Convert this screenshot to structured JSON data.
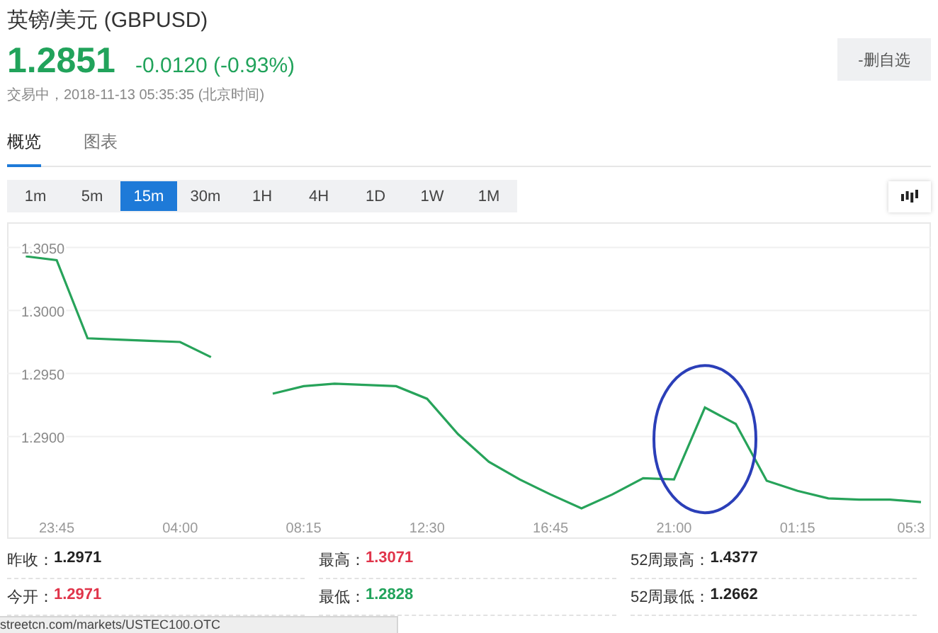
{
  "header": {
    "title": "英镑/美元 (GBPUSD)",
    "price": "1.2851",
    "change": "-0.0120 (-0.93%)",
    "status": "交易中，2018-11-13 05:35:35 (北京时间)",
    "watch_button": "-删自选"
  },
  "tabs": [
    {
      "label": "概览",
      "selected": true
    },
    {
      "label": "图表",
      "selected": false
    }
  ],
  "periods": [
    {
      "label": "1m",
      "selected": false
    },
    {
      "label": "5m",
      "selected": false
    },
    {
      "label": "15m",
      "selected": true
    },
    {
      "label": "30m",
      "selected": false
    },
    {
      "label": "1H",
      "selected": false
    },
    {
      "label": "4H",
      "selected": false
    },
    {
      "label": "1D",
      "selected": false
    },
    {
      "label": "1W",
      "selected": false
    },
    {
      "label": "1M",
      "selected": false
    }
  ],
  "chart": {
    "chart_data": {
      "type": "line",
      "grid": true,
      "ylim": [
        1.282,
        1.307
      ],
      "categories": [
        null,
        "23:45",
        null,
        null,
        null,
        "04:00",
        null,
        null,
        null,
        "08:15",
        null,
        null,
        null,
        "12:30",
        null,
        null,
        null,
        "16:45",
        null,
        null,
        null,
        "21:00",
        null,
        null,
        null,
        "01:15",
        null,
        null,
        null,
        "05:3"
      ],
      "yticks": [
        {
          "value": 1.305,
          "label": "1.3050"
        },
        {
          "value": 1.3,
          "label": "1.3000"
        },
        {
          "value": 1.295,
          "label": "1.2950"
        },
        {
          "value": 1.29,
          "label": "1.2900"
        }
      ],
      "series": [
        {
          "color": "#27a35a",
          "values": [
            1.3043,
            1.304,
            1.2978,
            1.2977,
            1.2976,
            1.2975,
            1.2963,
            null,
            1.2934,
            1.294,
            1.2942,
            1.2941,
            1.294,
            1.293,
            1.2902,
            1.288,
            1.2866,
            1.2854,
            1.2843,
            1.2854,
            1.2867,
            1.2866,
            1.2923,
            1.291,
            1.2865,
            1.2857,
            1.2851,
            1.285,
            1.285,
            1.2848
          ]
        }
      ]
    },
    "highlight_circle": true
  },
  "stats": [
    {
      "label": "昨收：",
      "value": "1.2971",
      "color": "#222222"
    },
    {
      "label": "最高：",
      "value": "1.3071",
      "color": "#e0344a"
    },
    {
      "label": "52周最高：",
      "value": "1.4377",
      "color": "#222222"
    },
    {
      "label": "今开：",
      "value": "1.2971",
      "color": "#e0344a"
    },
    {
      "label": "最低：",
      "value": "1.2828",
      "color": "#21a35b"
    },
    {
      "label": "52周最低：",
      "value": "1.2662",
      "color": "#222222"
    }
  ],
  "status_bar": {
    "url": "streetcn.com/markets/USTEC100.OTC"
  }
}
